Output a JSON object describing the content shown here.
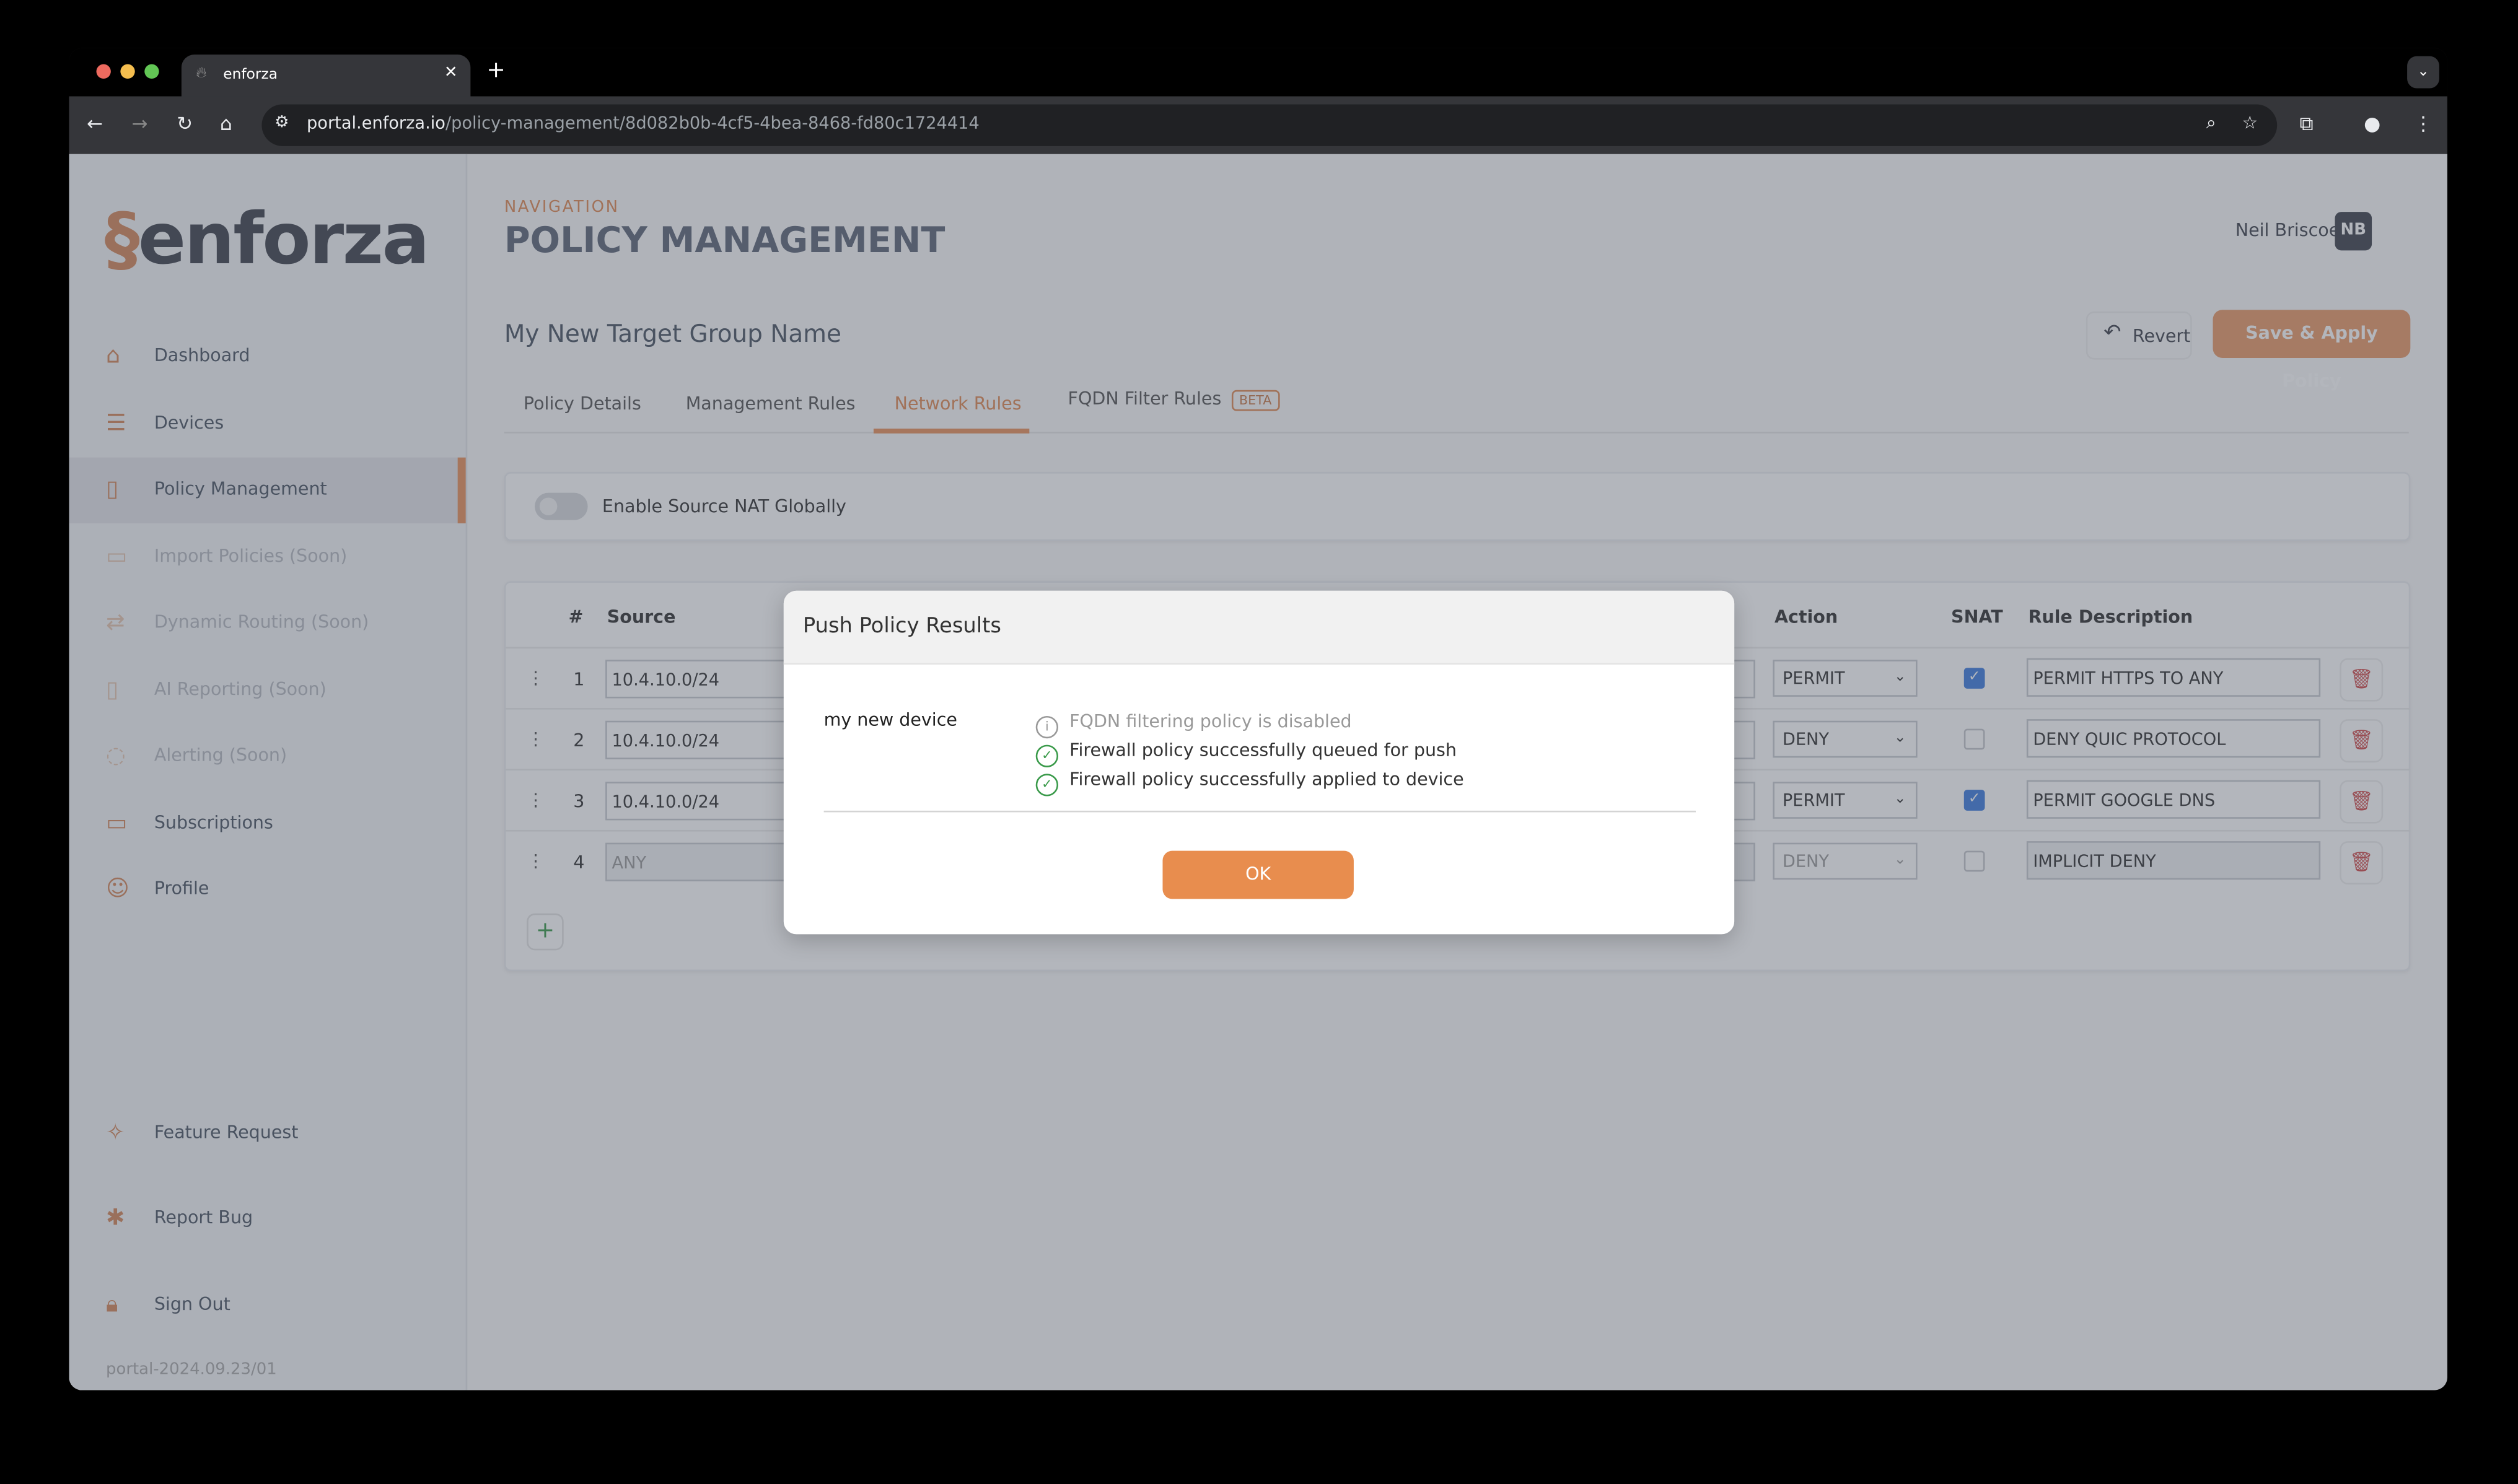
{
  "browser": {
    "tab_title": "enforza",
    "url_host": "portal.enforza.io",
    "url_path": "/policy-management/8d082b0b-4cf5-4bea-8468-fd80c1724414"
  },
  "sidebar": {
    "logo_text": "enforza",
    "items": [
      {
        "label": "Dashboard",
        "icon": "home-icon"
      },
      {
        "label": "Devices",
        "icon": "server-icon"
      },
      {
        "label": "Policy Management",
        "icon": "document-icon"
      },
      {
        "label": "Import Policies (Soon)",
        "icon": "folder-import-icon"
      },
      {
        "label": "Dynamic Routing (Soon)",
        "icon": "arrows-icon"
      },
      {
        "label": "AI Reporting (Soon)",
        "icon": "report-icon"
      },
      {
        "label": "Alerting (Soon)",
        "icon": "bell-icon"
      },
      {
        "label": "Subscriptions",
        "icon": "credit-card-icon"
      },
      {
        "label": "Profile",
        "icon": "user-icon"
      }
    ],
    "bottom_items": [
      {
        "label": "Feature Request",
        "icon": "sparkles-icon"
      },
      {
        "label": "Report Bug",
        "icon": "bug-icon"
      },
      {
        "label": "Sign Out",
        "icon": "lock-icon"
      }
    ],
    "version": "portal-2024.09.23/01"
  },
  "header": {
    "nav_label": "NAVIGATION",
    "title": "POLICY MANAGEMENT",
    "user_name": "Neil Briscoe",
    "user_initials": "NB"
  },
  "group_name": "My New Target Group Name",
  "buttons": {
    "revert": "Revert",
    "save": "Save & Apply Policy"
  },
  "tabs": [
    {
      "label": "Policy Details"
    },
    {
      "label": "Management Rules"
    },
    {
      "label": "Network Rules",
      "active": true
    },
    {
      "label": "FQDN Filter Rules",
      "badge": "BETA"
    }
  ],
  "snat_global": {
    "label": "Enable Source NAT Globally",
    "enabled": false
  },
  "table": {
    "headers": {
      "num": "#",
      "source": "Source",
      "action": "Action",
      "snat": "SNAT",
      "description": "Rule Description"
    },
    "rows": [
      {
        "num": "1",
        "source": "10.4.10.0/24",
        "action": "PERMIT",
        "snat": true,
        "description": "PERMIT HTTPS TO ANY"
      },
      {
        "num": "2",
        "source": "10.4.10.0/24",
        "action": "DENY",
        "snat": false,
        "description": "DENY QUIC PROTOCOL"
      },
      {
        "num": "3",
        "source": "10.4.10.0/24",
        "action": "PERMIT",
        "snat": true,
        "description": "PERMIT GOOGLE DNS"
      },
      {
        "num": "4",
        "source": "ANY",
        "action": "DENY",
        "snat": false,
        "description": "IMPLICIT DENY"
      }
    ]
  },
  "modal": {
    "title": "Push Policy Results",
    "device": "my new device",
    "messages": [
      {
        "type": "info",
        "text": "FQDN filtering policy is disabled"
      },
      {
        "type": "success",
        "text": "Firewall policy successfully queued for push"
      },
      {
        "type": "success",
        "text": "Firewall policy successfully applied to device"
      }
    ],
    "ok_label": "OK"
  },
  "colors": {
    "accent": "#e8925c",
    "success": "#3a9a4a",
    "danger": "#d14b4b",
    "checkbox": "#3f7cde"
  }
}
